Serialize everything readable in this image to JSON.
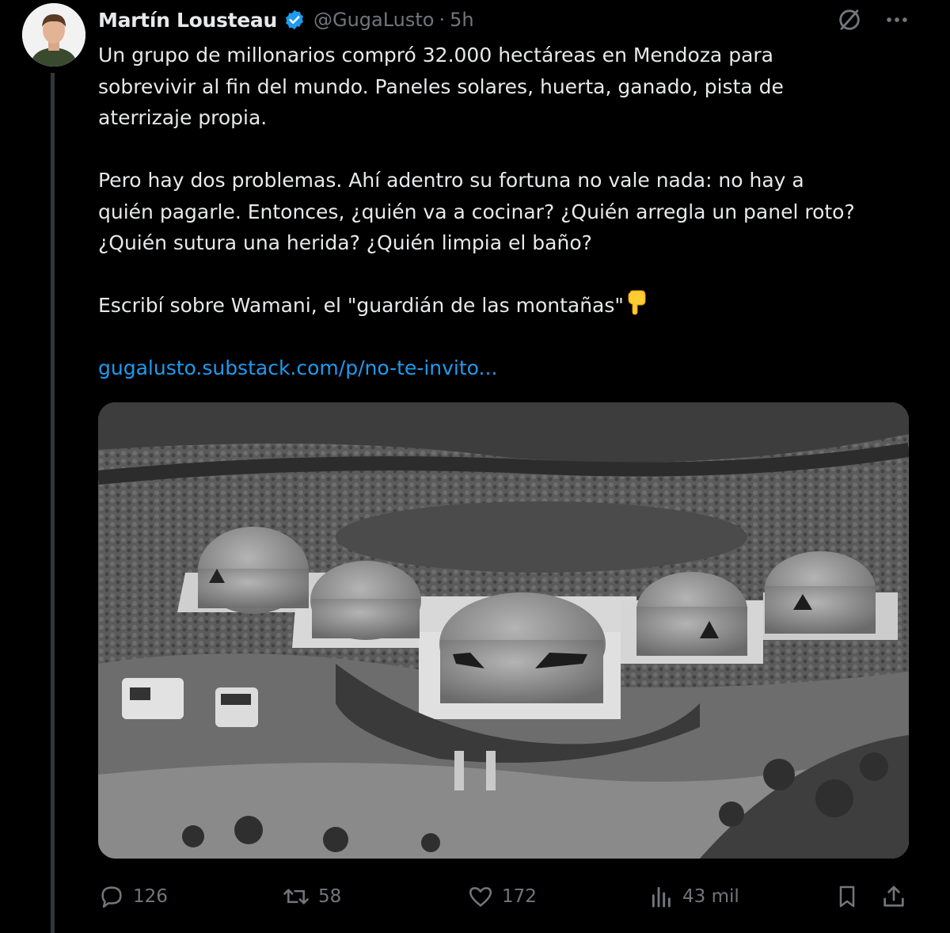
{
  "author": {
    "name": "Martín Lousteau",
    "handle": "@GugaLusto",
    "separator": "·",
    "time": "5h"
  },
  "tweet": {
    "p1_line1": "Un grupo de millonarios compró 32.000 hectáreas en Mendoza para",
    "p1_line2": "sobrevivir al fin del mundo. Paneles solares, huerta, ganado, pista de",
    "p1_line3": "aterrizaje propia.",
    "p2_line1": "Pero hay dos problemas. Ahí adentro su fortuna no vale nada: no hay a",
    "p2_line2": "quién pagarle. Entonces, ¿quién va a cocinar? ¿Quién arregla un panel roto?",
    "p2_line3": "¿Quién sutura una herida? ¿Quién limpia el baño?",
    "p3": "Escribí sobre Wamani, el \"guardián de las montañas\"",
    "link": "gugalusto.substack.com/p/no-te-invito..."
  },
  "actions": {
    "replies": "126",
    "retweets": "58",
    "likes": "172",
    "views": "43 mil"
  },
  "icons": [
    "grok-icon",
    "more-icon",
    "verified-badge-icon",
    "pointing-down-emoji",
    "reply-icon",
    "retweet-icon",
    "like-icon",
    "views-icon",
    "bookmark-icon",
    "share-icon"
  ],
  "colors": {
    "background": "#000000",
    "text": "#e7e9ea",
    "secondary": "#71767b",
    "link": "#1d9bf0",
    "verified": "#1d9bf0"
  }
}
